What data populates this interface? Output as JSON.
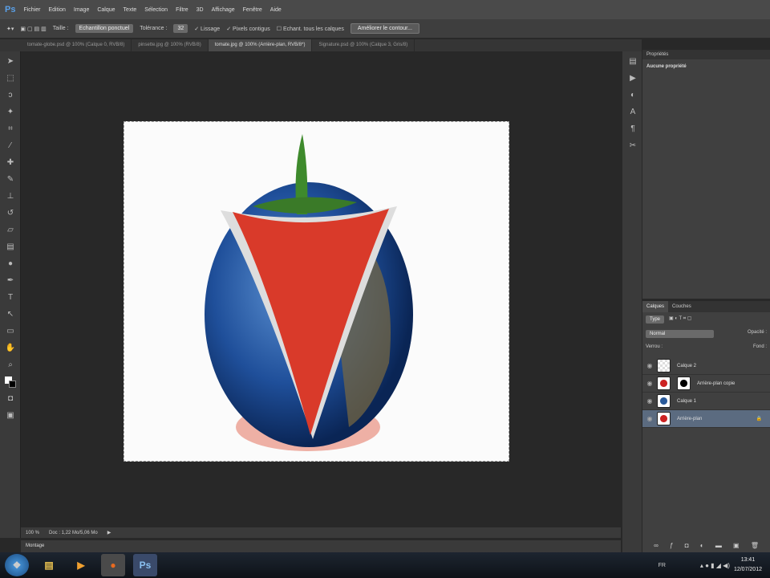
{
  "app": {
    "logo": "Ps"
  },
  "menu": [
    "Fichier",
    "Edition",
    "Image",
    "Calque",
    "Texte",
    "Sélection",
    "Filtre",
    "3D",
    "Affichage",
    "Fenêtre",
    "Aide"
  ],
  "options": {
    "size_label": "Taille :",
    "size_value": "Echantillon ponctuel",
    "tolerance_label": "Tolérance :",
    "tolerance_value": "32",
    "lissage": "Lissage",
    "contigu": "Pixels contigus",
    "all_layers": "Echant. tous les calques",
    "refine": "Améliorer le contour..."
  },
  "tabs": [
    {
      "label": "tomate-globe.psd @ 100% (Calque 0, RVB/8)"
    },
    {
      "label": "pinsette.jpg @ 100% (RVB/8)"
    },
    {
      "label": "tomate.jpg @ 100% (Arrière-plan, RVB/8*)",
      "active": true
    },
    {
      "label": "Signature.psd @ 100% (Calque 3, Gris/8)"
    }
  ],
  "status": {
    "zoom": "100 %",
    "doc": "Doc : 1,22 Mo/5,06 Mo"
  },
  "bottom_panel": "Montage",
  "properties": {
    "tab": "Propriétés",
    "text": "Aucune propriété"
  },
  "layers_panel": {
    "tabs": [
      "Calques",
      "Couches"
    ],
    "filter": "Type",
    "blend": "Normal",
    "opacity_label": "Opacité :",
    "lock_label": "Verrou :",
    "fill_label": "Fond :",
    "layers": [
      {
        "name": "Calque 2",
        "thumb": "transparent"
      },
      {
        "name": "Arrière-plan copie",
        "thumb": "tomato",
        "mask": true
      },
      {
        "name": "Calque 1",
        "thumb": "globe"
      },
      {
        "name": "Arrière-plan",
        "thumb": "tomato",
        "selected": true,
        "locked": true
      }
    ]
  },
  "taskbar": {
    "lang": "FR",
    "time": "13:41",
    "date": "12/07/2012"
  },
  "colors": {
    "accent": "#5aa0e8",
    "selected_layer": "#5b6b80"
  }
}
